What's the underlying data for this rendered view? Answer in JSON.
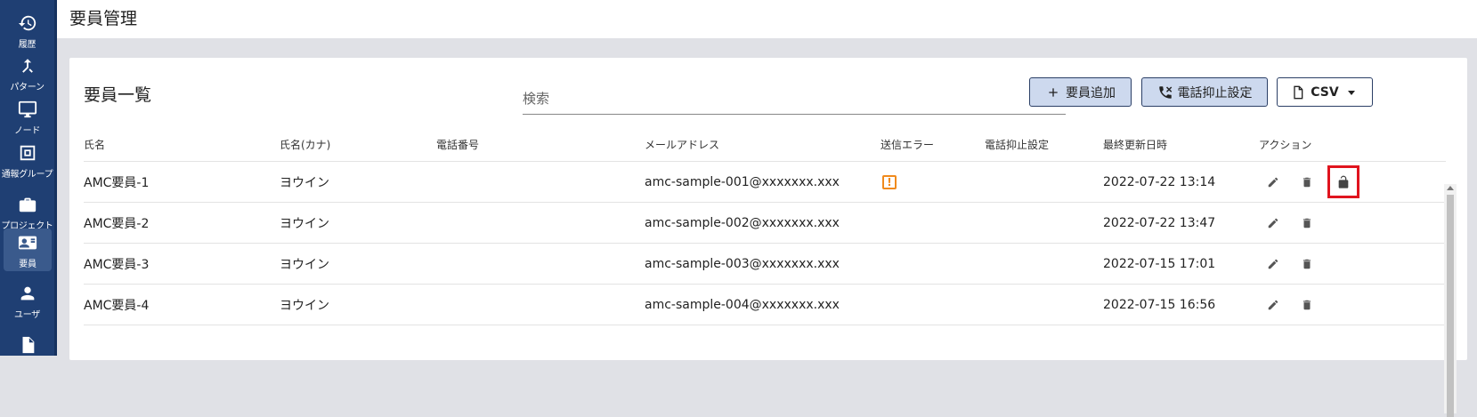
{
  "header": {
    "title": "要員管理"
  },
  "sidebar": {
    "items": [
      {
        "label": "履歴",
        "icon": "history-icon"
      },
      {
        "label": "パターン",
        "icon": "merge-arrow-icon"
      },
      {
        "label": "ノード",
        "icon": "monitor-icon"
      },
      {
        "label": "通報グループ",
        "icon": "group-frame-icon"
      },
      {
        "label": "プロジェクト",
        "icon": "briefcase-icon"
      },
      {
        "label": "要員",
        "icon": "contact-card-icon",
        "active": true
      },
      {
        "label": "ユーザ",
        "icon": "person-icon"
      }
    ]
  },
  "main": {
    "card_title": "要員一覧",
    "search": {
      "placeholder": "検索",
      "value": ""
    },
    "buttons": {
      "add": "要員追加",
      "phone_block": "電話抑止設定",
      "csv": "CSV"
    },
    "table": {
      "headers": [
        "氏名",
        "氏名(カナ)",
        "電話番号",
        "メールアドレス",
        "送信エラー",
        "電話抑止設定",
        "最終更新日時",
        "アクション"
      ],
      "rows": [
        {
          "name": "AMC要員-1",
          "kana": "ヨウイン",
          "phone": "",
          "email": "amc-sample-001@xxxxxxx.xxx",
          "send_error": true,
          "phone_block": "",
          "updated": "2022-07-22 13:14",
          "locked": true
        },
        {
          "name": "AMC要員-2",
          "kana": "ヨウイン",
          "phone": "",
          "email": "amc-sample-002@xxxxxxx.xxx",
          "send_error": false,
          "phone_block": "",
          "updated": "2022-07-22 13:47",
          "locked": false
        },
        {
          "name": "AMC要員-3",
          "kana": "ヨウイン",
          "phone": "",
          "email": "amc-sample-003@xxxxxxx.xxx",
          "send_error": false,
          "phone_block": "",
          "updated": "2022-07-15 17:01",
          "locked": false
        },
        {
          "name": "AMC要員-4",
          "kana": "ヨウイン",
          "phone": "",
          "email": "amc-sample-004@xxxxxxx.xxx",
          "send_error": false,
          "phone_block": "",
          "updated": "2022-07-15 16:56",
          "locked": false
        }
      ]
    }
  },
  "colors": {
    "sidebar_bg": "#1f3f73",
    "link": "#2a6fc4",
    "button_fill": "#cdd9ee",
    "error_orange": "#f08a1c",
    "highlight_red": "#e0141e"
  }
}
